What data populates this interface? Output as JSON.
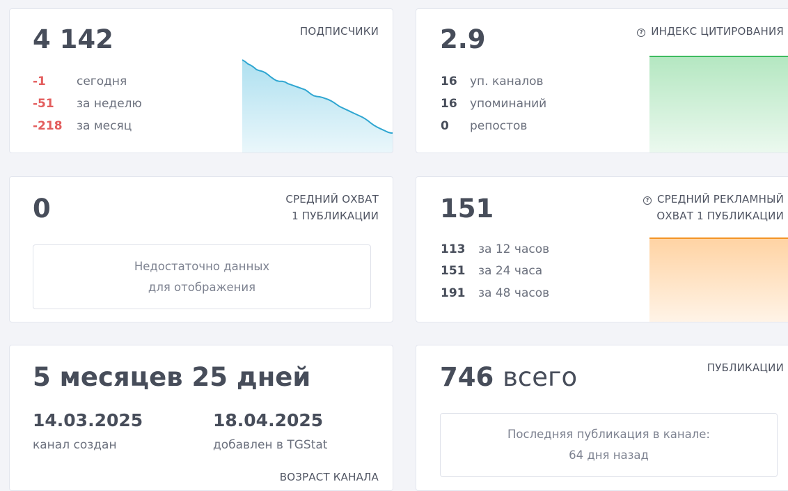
{
  "subscribers": {
    "value": "4 142",
    "label": "ПОДПИСЧИКИ",
    "stats": [
      {
        "num": "-1",
        "label": "сегодня"
      },
      {
        "num": "-51",
        "label": "за неделю"
      },
      {
        "num": "-218",
        "label": "за месяц"
      }
    ],
    "chart_data": {
      "type": "area",
      "values": [
        4360,
        4355,
        4348,
        4344,
        4338,
        4331,
        4328,
        4326,
        4322,
        4316,
        4309,
        4303,
        4298,
        4296,
        4296,
        4294,
        4289,
        4286,
        4283,
        4280,
        4277,
        4274,
        4271,
        4265,
        4258,
        4253,
        4251,
        4250,
        4248,
        4245,
        4242,
        4238,
        4233,
        4227,
        4221,
        4217,
        4213,
        4209,
        4205,
        4201,
        4197,
        4193,
        4189,
        4184,
        4178,
        4171,
        4165,
        4160,
        4156,
        4152,
        4148,
        4144,
        4142,
        4142
      ],
      "color": "#2fa6d1",
      "fill": "#aee0f0"
    }
  },
  "citation": {
    "value": "2.9",
    "label": "ИНДЕКС ЦИТИРОВАНИЯ",
    "stats": [
      {
        "num": "16",
        "label": "уп. каналов"
      },
      {
        "num": "16",
        "label": "упоминаний"
      },
      {
        "num": "0",
        "label": "репостов"
      }
    ],
    "chart_data": {
      "type": "area",
      "values": [
        2.9,
        2.9,
        2.9,
        2.9,
        2.9
      ],
      "color": "#3dbb5e",
      "fill": "#b4e7c1"
    }
  },
  "reach": {
    "value": "0",
    "label_line1": "СРЕДНИЙ ОХВАТ",
    "label_line2": "1 ПУБЛИКАЦИИ",
    "nodata_line1": "Недостаточно данных",
    "nodata_line2": "для отображения"
  },
  "ad_reach": {
    "value": "151",
    "label_line1": "СРЕДНИЙ РЕКЛАМНЫЙ",
    "label_line2": "ОХВАТ 1 ПУБЛИКАЦИИ",
    "stats": [
      {
        "num": "113",
        "label": "за 12 часов"
      },
      {
        "num": "151",
        "label": "за 24 часа"
      },
      {
        "num": "191",
        "label": "за 48 часов"
      }
    ],
    "chart_data": {
      "type": "area",
      "values": [
        151,
        151,
        151,
        151,
        151
      ],
      "color": "#f39425",
      "fill": "#ffd3a3"
    }
  },
  "age": {
    "value": "5 месяцев 25 дней",
    "created_date": "14.03.2025",
    "created_label": "канал создан",
    "added_date": "18.04.2025",
    "added_label": "добавлен в TGStat",
    "label": "ВОЗРАСТ КАНАЛА"
  },
  "publications": {
    "value_num": "746",
    "value_word": "всего",
    "label": "ПУБЛИКАЦИИ",
    "last_line1": "Последняя публикация в канале:",
    "last_line2": "64 дня назад"
  }
}
